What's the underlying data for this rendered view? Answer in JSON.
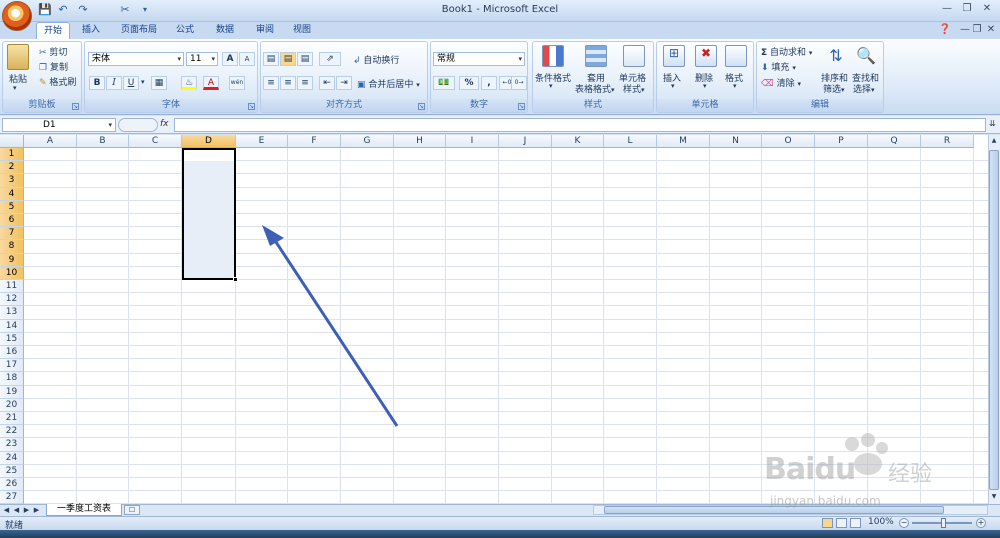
{
  "window": {
    "title": "Book1 - Microsoft Excel"
  },
  "quick_access": {
    "save_icon": "save-icon",
    "undo_icon": "undo-icon",
    "redo_icon": "redo-icon",
    "customize_icon": "customize-icon"
  },
  "tabs": [
    "开始",
    "插入",
    "页面布局",
    "公式",
    "数据",
    "审阅",
    "视图"
  ],
  "active_tab": "开始",
  "ribbon": {
    "clipboard": {
      "label": "剪贴板",
      "paste": "粘贴",
      "cut": "剪切",
      "copy": "复制",
      "format_painter": "格式刷"
    },
    "font": {
      "label": "字体",
      "font_name": "宋体",
      "font_size": "11",
      "grow": "A",
      "shrink": "A",
      "bold": "B",
      "italic": "I",
      "underline": "U",
      "font_color_glyph": "A",
      "wen": "wén"
    },
    "alignment": {
      "label": "对齐方式",
      "wrap_text": "自动换行",
      "merge_center": "合并后居中"
    },
    "number": {
      "label": "数字",
      "format": "常规",
      "percent": "%",
      "comma": ","
    },
    "styles": {
      "label": "样式",
      "conditional": "条件格式",
      "table_line1": "套用",
      "table_line2": "表格格式",
      "cell_line1": "单元格",
      "cell_line2": "样式"
    },
    "cells": {
      "label": "单元格",
      "insert": "插入",
      "delete": "删除",
      "format": "格式"
    },
    "editing": {
      "label": "编辑",
      "autosum": "自动求和",
      "fill": "填充",
      "clear": "清除",
      "sort_line1": "排序和",
      "sort_line2": "筛选",
      "find_line1": "查找和",
      "find_line2": "选择"
    }
  },
  "formula_bar": {
    "name_box": "D1",
    "fx": "fx",
    "value": ""
  },
  "columns": [
    "A",
    "B",
    "C",
    "D",
    "E",
    "F",
    "G",
    "H",
    "I",
    "J",
    "K",
    "L",
    "M",
    "N",
    "O",
    "P",
    "Q",
    "R"
  ],
  "rows": [
    "1",
    "2",
    "3",
    "4",
    "5",
    "6",
    "7",
    "8",
    "9",
    "10",
    "11",
    "12",
    "13",
    "14",
    "15",
    "16",
    "17",
    "18",
    "19",
    "20",
    "21",
    "22",
    "23",
    "24",
    "25",
    "26",
    "27"
  ],
  "selection": {
    "range": "D1:D10",
    "active_cell": "D1"
  },
  "sheet_tabs": [
    "一季度工资表"
  ],
  "status": {
    "ready": "就绪",
    "zoom": "100%"
  },
  "annotation": {
    "arrow_color": "#3d5fb5"
  },
  "watermark": {
    "brand": "Baidu",
    "cn": "经验",
    "url": "jingyan.baidu.com"
  }
}
